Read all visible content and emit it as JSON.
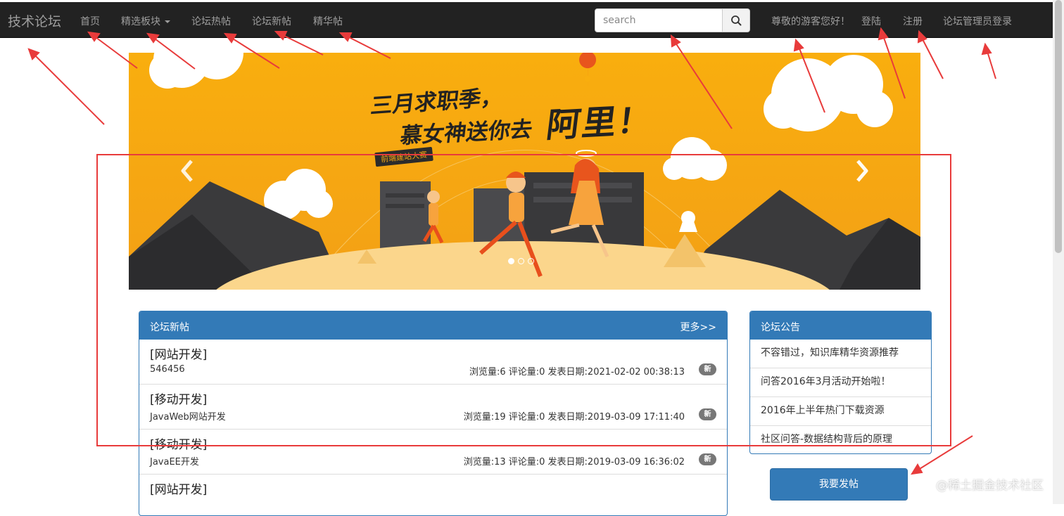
{
  "nav": {
    "brand": "技术论坛",
    "items": [
      {
        "label": "首页"
      },
      {
        "label": "精选板块"
      },
      {
        "label": "论坛热帖"
      },
      {
        "label": "论坛新帖"
      },
      {
        "label": "精华帖"
      }
    ],
    "search_placeholder": "search",
    "greeting": "尊敬的游客您好！",
    "login": "登陆",
    "register": "注册",
    "admin_login": "论坛管理员登录"
  },
  "banner": {
    "headline_1": "三月求职季，",
    "headline_2": "慕女神送你去",
    "headline_3": "阿里！",
    "tag": "前端建站大赛"
  },
  "new_posts": {
    "title": "论坛新帖",
    "more": "更多>>",
    "posts": [
      {
        "category": "[网站开发]",
        "desc": "546456",
        "meta": "浏览量:6 评论量:0 发表日期:2021-02-02 00:38:13",
        "badge": "新"
      },
      {
        "category": "[移动开发]",
        "desc": "JavaWeb网站开发",
        "meta": "浏览量:19 评论量:0 发表日期:2019-03-09 17:11:40",
        "badge": "新"
      },
      {
        "category": "[移动开发]",
        "desc": "JavaEE开发",
        "meta": "浏览量:13 评论量:0 发表日期:2019-03-09 16:36:02",
        "badge": "新"
      },
      {
        "category": "[网站开发]",
        "desc": "",
        "meta": "",
        "badge": ""
      }
    ]
  },
  "notices": {
    "title": "论坛公告",
    "items": [
      {
        "label": "不容错过，知识库精华资源推荐"
      },
      {
        "label": "问答2016年3月活动开始啦！"
      },
      {
        "label": "2016年上半年热门下载资源"
      },
      {
        "label": "社区问答-数据结构背后的原理"
      }
    ]
  },
  "post_button": "我要发帖",
  "watermark": "@稀土掘金技术社区",
  "colors": {
    "navbar": "#222222",
    "primary": "#337ab7",
    "banner": "#f5a613",
    "annotation": "#e83b3b"
  }
}
